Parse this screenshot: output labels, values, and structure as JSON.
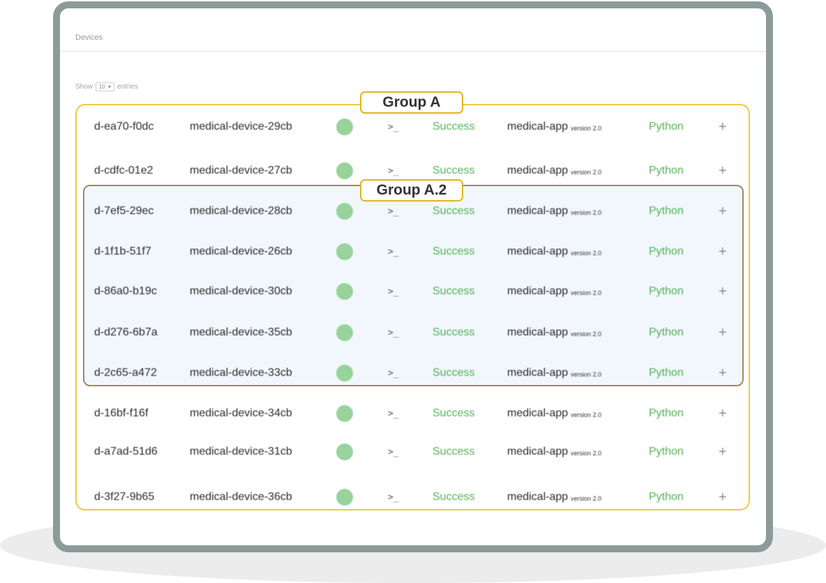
{
  "page": {
    "title": "Devices",
    "show_label": "Show",
    "entries_value": "10",
    "entries_label": "entries"
  },
  "groups": {
    "outer_label": "Group A",
    "inner_label": "Group A.2"
  },
  "colors": {
    "frame": "#8c9b9a",
    "outer_group_border": "#f2c744",
    "inner_group_border": "#9d8a62",
    "inner_group_fill": "#f1f7fc",
    "status_dot": "#97d39b",
    "success_text": "#52b356"
  },
  "icons": {
    "status": "status-dot-icon",
    "terminal": "terminal-icon",
    "add": "plus-icon",
    "dropdown": "chevron-down-icon"
  },
  "terminal_glyph": ">_",
  "plus_glyph": "+",
  "dropdown_glyph": "▾",
  "rows": [
    {
      "id": "d-ea70-f0dc",
      "name": "medical-device-29cb",
      "status": "Success",
      "app": "medical-app",
      "version": "version 2.0",
      "language": "Python"
    },
    {
      "id": "d-cdfc-01e2",
      "name": "medical-device-27cb",
      "status": "Success",
      "app": "medical-app",
      "version": "version 2.0",
      "language": "Python"
    },
    {
      "id": "d-7ef5-29ec",
      "name": "medical-device-28cb",
      "status": "Success",
      "app": "medical-app",
      "version": "version 2.0",
      "language": "Python"
    },
    {
      "id": "d-1f1b-51f7",
      "name": "medical-device-26cb",
      "status": "Success",
      "app": "medical-app",
      "version": "version 2.0",
      "language": "Python"
    },
    {
      "id": "d-86a0-b19c",
      "name": "medical-device-30cb",
      "status": "Success",
      "app": "medical-app",
      "version": "version 2.0",
      "language": "Python"
    },
    {
      "id": "d-d276-6b7a",
      "name": "medical-device-35cb",
      "status": "Success",
      "app": "medical-app",
      "version": "version 2.0",
      "language": "Python"
    },
    {
      "id": "d-2c65-a472",
      "name": "medical-device-33cb",
      "status": "Success",
      "app": "medical-app",
      "version": "version 2.0",
      "language": "Python"
    },
    {
      "id": "d-16bf-f16f",
      "name": "medical-device-34cb",
      "status": "Success",
      "app": "medical-app",
      "version": "version 2.0",
      "language": "Python"
    },
    {
      "id": "d-a7ad-51d6",
      "name": "medical-device-31cb",
      "status": "Success",
      "app": "medical-app",
      "version": "version 2.0",
      "language": "Python"
    },
    {
      "id": "d-3f27-9b65",
      "name": "medical-device-36cb",
      "status": "Success",
      "app": "medical-app",
      "version": "version 2.0",
      "language": "Python"
    }
  ]
}
